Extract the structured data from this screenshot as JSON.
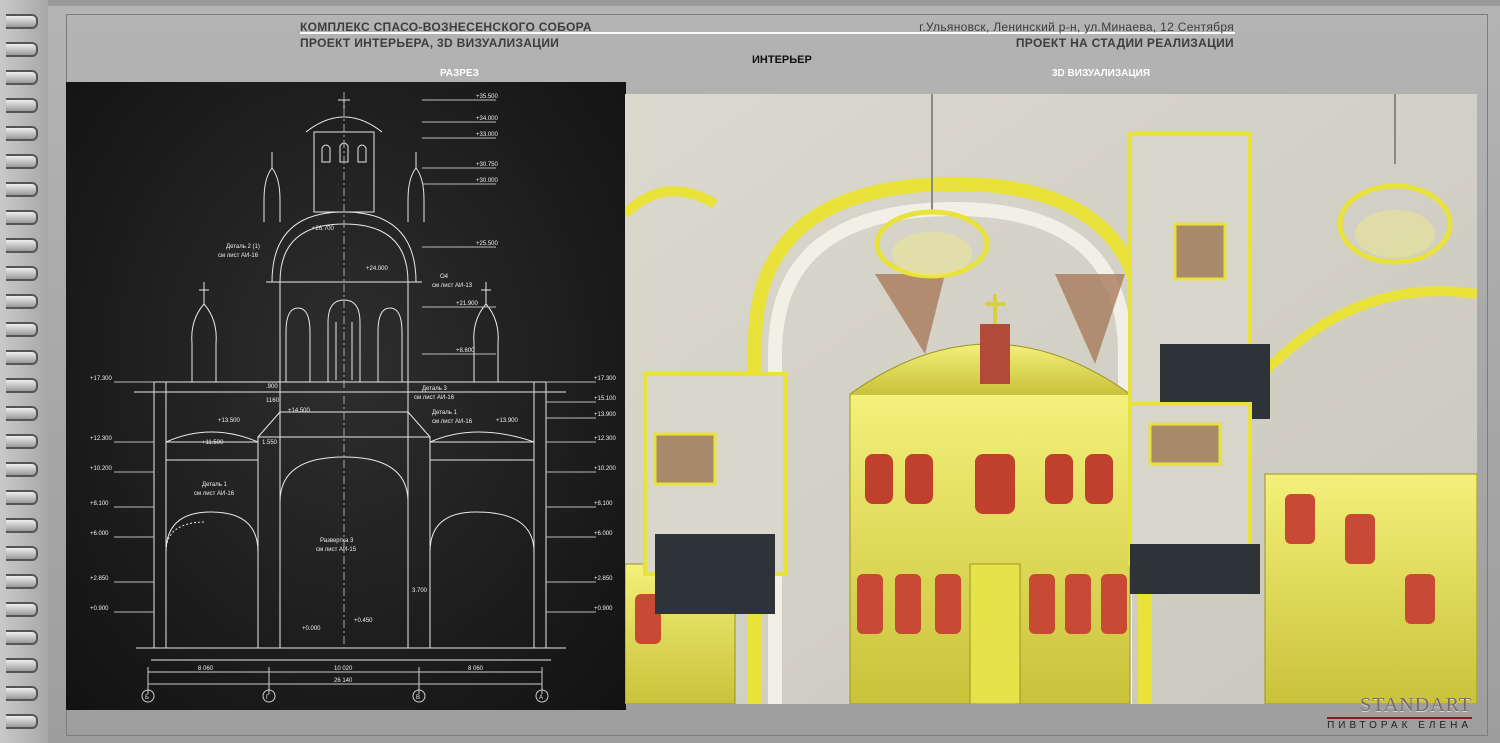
{
  "header": {
    "title_left_1": "КОМПЛЕКС СПАСО-ВОЗНЕСЕНСКОГО СОБОРА",
    "title_left_2": "ПРОЕКТ ИНТЕРЬЕРА, 3D ВИЗУАЛИЗАЦИИ",
    "title_right_1": "г.Ульяновск, Ленинский р-н, ул.Минаева, 12 Сентября",
    "title_right_2": "ПРОЕКТ НА СТАДИИ РЕАЛИЗАЦИИ",
    "center_label": "ИНТЕРЬЕР"
  },
  "panels": {
    "left_label": "РАЗРЕЗ",
    "right_label": "3D ВИЗУАЛИЗАЦИЯ"
  },
  "drawing": {
    "elevations_left": [
      "+17.300",
      "+12.300",
      "+10.200",
      "+8.100",
      "+6.000",
      "+2.850",
      "+0.900"
    ],
    "elevations_right": [
      "+17.300",
      "+15.100",
      "+13.900",
      "+12.300",
      "+10.200",
      "+8.100",
      "+6.000",
      "+2.850",
      "+0.900"
    ],
    "elevations_top": [
      "+35.500",
      "+34.000",
      "+33.000",
      "+30.750",
      "+30.000",
      "+25.500",
      "+21.900",
      "+8.600"
    ],
    "notes": [
      {
        "text": "Деталь 2 (1)",
        "sub": "см лист АИ-16"
      },
      {
        "text": "О4",
        "sub": "см лист АИ-13"
      },
      {
        "text": "Деталь 3",
        "sub": "см лист АИ-16"
      },
      {
        "text": "Деталь 1",
        "sub": "см лист АИ-16"
      },
      {
        "text": "Деталь 1",
        "sub": "см лист АИ-16"
      },
      {
        "text": "Развертка 3",
        "sub": "см лист АИ-15"
      }
    ],
    "dims_bottom": [
      "8 060",
      "10 020",
      "8 060"
    ],
    "dim_total": "26 140",
    "axes": [
      "Б",
      "Г",
      "В",
      "А"
    ],
    "misc": [
      "+24.000",
      "+26.700",
      "+14.500",
      "+13.500",
      "+11.500",
      "+13.900",
      "1.550",
      "1160",
      ".900",
      "+0.000",
      "+0.450",
      "3.700"
    ]
  },
  "logo": {
    "brand": "STANDART",
    "author": "ПИВТОРАК ЕЛЕНА"
  }
}
